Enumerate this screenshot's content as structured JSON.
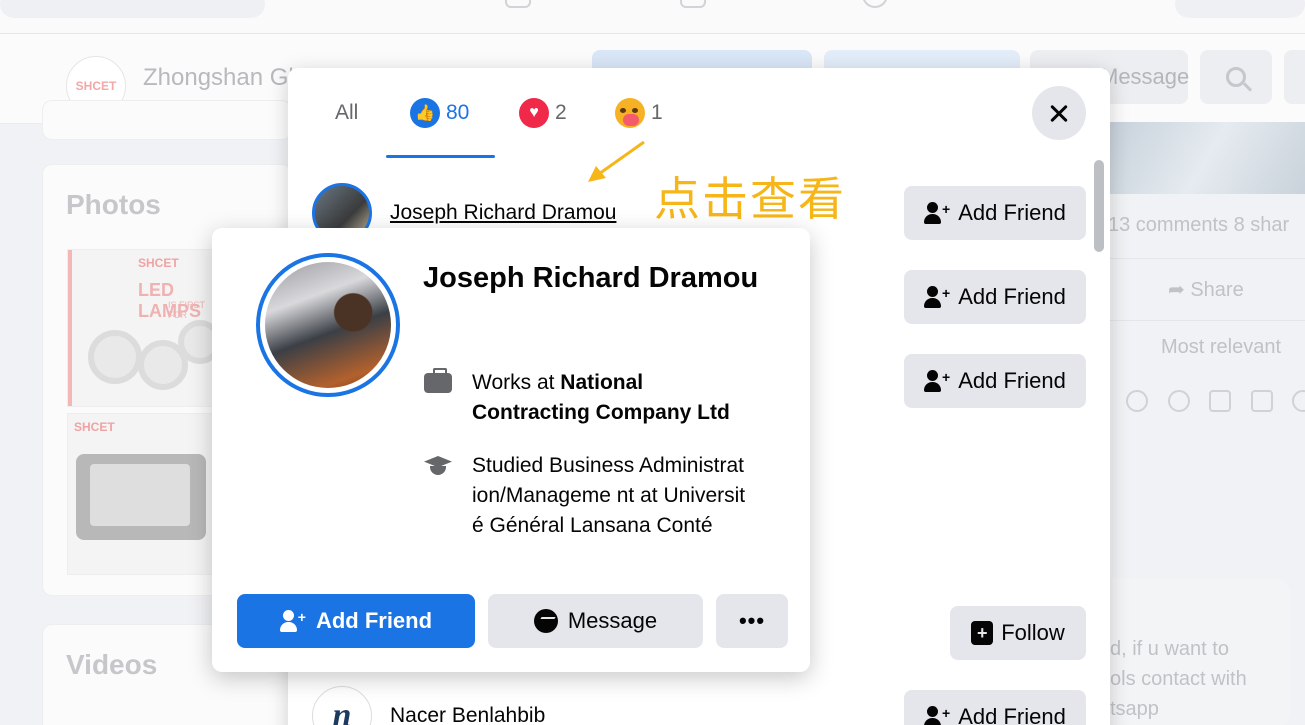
{
  "background": {
    "page_name": "Zhongshan Gl",
    "logo_text": "SHCET",
    "message_label": "Message",
    "photos_title": "Photos",
    "videos_title": "Videos",
    "photo_brand": "SHCET",
    "photo_text": "LED LAMPS",
    "photo_subtext": "IS FIRST FOR",
    "comments_text": "13 comments  8 shar",
    "share_label": "Share",
    "most_relevant": "Most relevant",
    "comment_line1": "d, if u want to",
    "comment_line2": "ols contact with",
    "comment_line3": "tsapp"
  },
  "modal": {
    "tabs": [
      {
        "label": "All"
      },
      {
        "icon": "like-reaction-icon",
        "count": "80"
      },
      {
        "icon": "love-reaction-icon",
        "count": "2"
      },
      {
        "icon": "care-reaction-icon",
        "count": "1"
      }
    ],
    "active_tab": 1,
    "rows": [
      {
        "name": "Joseph Richard Dramou",
        "action": "Add Friend"
      },
      {
        "action": "Add Friend"
      },
      {
        "action": "Add Friend"
      },
      {
        "action": "Follow"
      },
      {
        "name": "Nacer Benlahbib",
        "action": "Add Friend"
      }
    ]
  },
  "hovercard": {
    "name": "Joseph Richard Dramou",
    "work_prefix": "Works at ",
    "work_place": "National Contracting Company Ltd",
    "study_text": "Studied Business Administration/Manageme nt at Université Général Lansana Conté",
    "add_friend_label": "Add Friend",
    "message_label": "Message",
    "more_label": "•••"
  },
  "annotation": {
    "text": "点击查看",
    "color": "#f6b619"
  },
  "colors": {
    "accent": "#1b74e4",
    "button_gray": "#e4e6eb",
    "love": "#f02849",
    "care": "#f7b125"
  }
}
